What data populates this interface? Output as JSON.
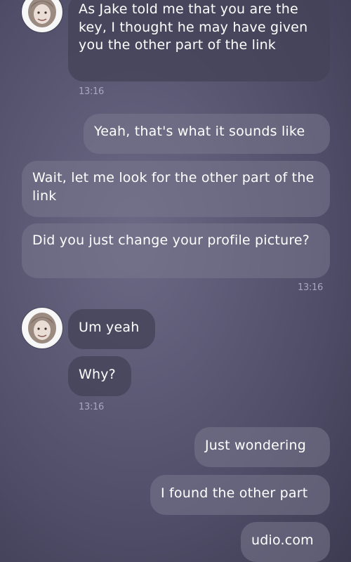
{
  "messages": [
    {
      "text": "As Jake told me that you are the key, I thought he may have given you the other part of the link"
    },
    {
      "text": "Yeah, that's what it sounds like"
    },
    {
      "text": "Wait, let me look for the other part of the link"
    },
    {
      "text": "Did you just change your profile picture?"
    },
    {
      "text": "Um yeah"
    },
    {
      "text": "Why?"
    },
    {
      "text": "Just wondering"
    },
    {
      "text": "I found the other part"
    },
    {
      "text": "udio.com"
    }
  ],
  "timestamps": {
    "t1": "13:16",
    "t2": "13:16",
    "t3": "13:16"
  },
  "colors": {
    "background": "#5a5873",
    "incoming_bubble": "#444258",
    "outgoing_bubble": "#7a788e",
    "timestamp": "#a9a7bd"
  }
}
